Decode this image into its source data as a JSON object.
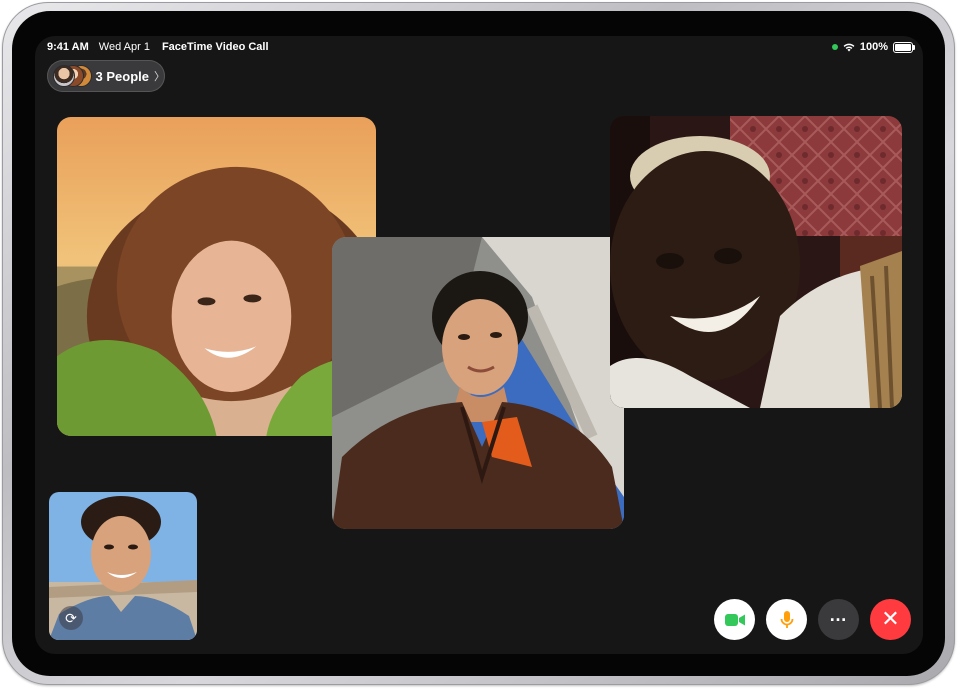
{
  "status_bar": {
    "time": "9:41 AM",
    "date": "Wed Apr 1",
    "title": "FaceTime Video Call",
    "battery": "100%",
    "icons": [
      "green-dot-indicator",
      "wifi-icon",
      "battery-icon"
    ]
  },
  "people_pill": {
    "label": "3 People",
    "chevron": "〉",
    "avatar_count": 3
  },
  "tiles": [
    {
      "name": "participant-curly-hair-woman"
    },
    {
      "name": "participant-man-in-leather-jacket"
    },
    {
      "name": "participant-smiling-man"
    },
    {
      "name": "self-view"
    }
  ],
  "self_view": {
    "flip_icon": "⟳"
  },
  "controls": [
    {
      "name": "camera-button",
      "icon": "video-camera-icon",
      "color": "#34c759"
    },
    {
      "name": "mic-button",
      "icon": "microphone-icon",
      "color": "#ff9f0a"
    },
    {
      "name": "more-button",
      "icon": "ellipsis-icon",
      "glyph": "…"
    },
    {
      "name": "end-call-button",
      "icon": "close-icon",
      "glyph": "✕",
      "color": "#ff3b3f"
    }
  ]
}
